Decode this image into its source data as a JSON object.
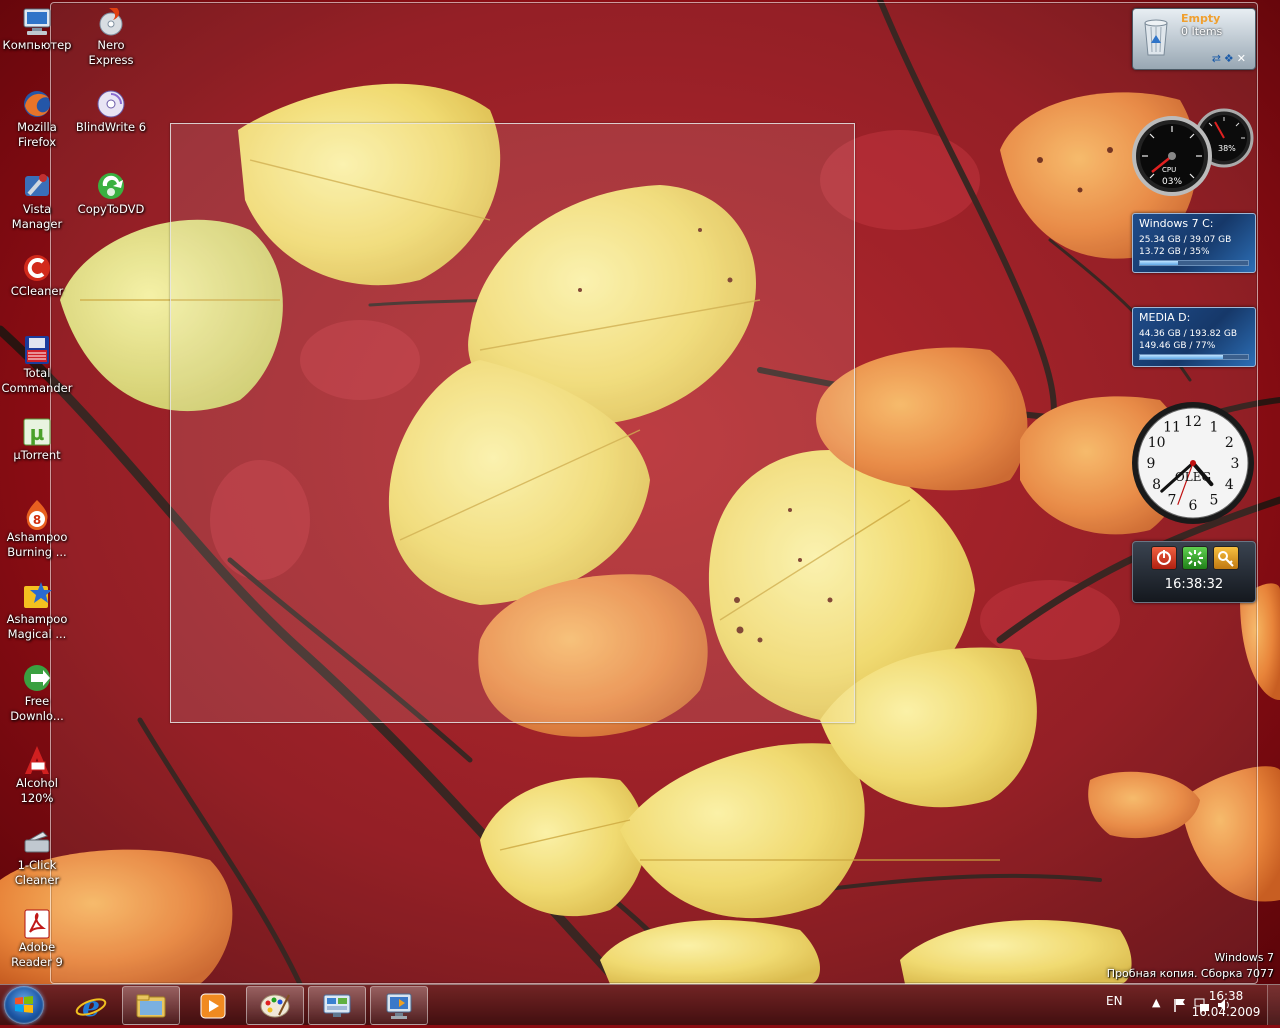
{
  "desktop_icons": [
    {
      "label": "Компьютер",
      "icon": "computer-icon"
    },
    {
      "label": "Nero Express",
      "icon": "nero-icon"
    },
    {
      "label": "Mozilla\nFirefox",
      "icon": "firefox-icon"
    },
    {
      "label": "BlindWrite 6",
      "icon": "blindwrite-icon"
    },
    {
      "label": "Vista\nManager",
      "icon": "vista-manager-icon"
    },
    {
      "label": "CopyToDVD",
      "icon": "copytodvd-icon"
    },
    {
      "label": "CCleaner",
      "icon": "ccleaner-icon"
    },
    {
      "label": "Total\nCommander",
      "icon": "total-commander-icon"
    },
    {
      "label": "µTorrent",
      "icon": "utorrent-icon"
    },
    {
      "label": "Ashampoo\nBurning ...",
      "icon": "ashampoo-burning-icon"
    },
    {
      "label": "Ashampoo\nMagical ...",
      "icon": "ashampoo-magical-icon"
    },
    {
      "label": "Free\nDownlo...",
      "icon": "free-download-icon"
    },
    {
      "label": "Alcohol\n120%",
      "icon": "alcohol-icon"
    },
    {
      "label": "1-Click\nCleaner",
      "icon": "one-click-cleaner-icon"
    },
    {
      "label": "Adobe\nReader 9",
      "icon": "adobe-reader-icon"
    }
  ],
  "gadgets": {
    "recycle_bin": {
      "title": "Empty",
      "count": "0 Items"
    },
    "meters": {
      "cpu": "03%",
      "ram": "38%"
    },
    "drive_c": {
      "name": "Windows 7 C:",
      "line1": "25.34 GB / 39.07 GB",
      "line2": "13.72 GB / 35%",
      "free_fraction": 0.35
    },
    "drive_d": {
      "name": "MEDIA D:",
      "line1": "44.36 GB / 193.82 GB",
      "line2": "149.46 GB / 77%",
      "free_fraction": 0.77
    },
    "clock": {
      "brand": "OLEG",
      "numerals": [
        "12",
        "1",
        "2",
        "3",
        "4",
        "5",
        "6",
        "7",
        "8",
        "9",
        "10",
        "11"
      ],
      "hour": 4,
      "minute": 38
    },
    "shutdown": {
      "time": "16:38:32"
    }
  },
  "watermark": {
    "line1": "Windows 7",
    "line2": "Пробная копия. Сборка 7077"
  },
  "taskbar": {
    "buttons": [
      {
        "icon": "internet-explorer-icon",
        "state": "pinned"
      },
      {
        "icon": "explorer-folder-icon",
        "state": "running"
      },
      {
        "icon": "media-player-icon",
        "state": "pinned"
      },
      {
        "icon": "paint-icon",
        "state": "running"
      },
      {
        "icon": "control-panel-icon",
        "state": "running"
      },
      {
        "icon": "remote-desktop-icon",
        "state": "running"
      }
    ],
    "language": "EN",
    "time": "16:38",
    "date": "16.04.2009"
  },
  "colors": {
    "accent": "#1d58a6",
    "wallpaper_red": "#8a0c12",
    "leaf_yellow": "#f0d860",
    "leaf_orange": "#e8803a"
  }
}
